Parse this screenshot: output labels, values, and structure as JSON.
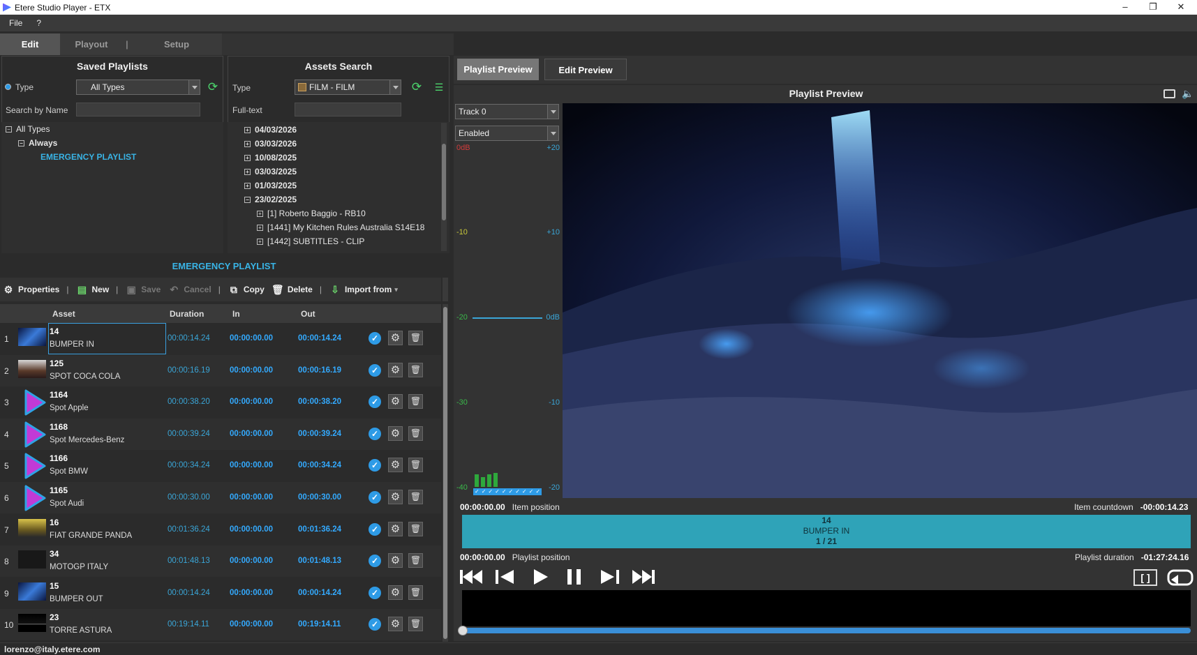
{
  "window": {
    "title": "Etere Studio Player - ETX",
    "min": "–",
    "max": "❐",
    "close": "✕"
  },
  "menu": [
    "File",
    "?"
  ],
  "main_tabs": [
    "Edit",
    "Playout",
    "|",
    "Setup"
  ],
  "saved_playlists": {
    "title": "Saved Playlists",
    "type_label": "Type",
    "type_value": "All Types",
    "search_label": "Search by Name",
    "tree": {
      "root": "All Types",
      "group": "Always",
      "item": "EMERGENCY PLAYLIST"
    }
  },
  "assets_search": {
    "title": "Assets Search",
    "type_label": "Type",
    "type_value": "FILM - FILM",
    "fulltext_label": "Full-text",
    "dates": [
      "04/03/2026",
      "03/03/2026",
      "10/08/2025",
      "03/03/2025",
      "01/03/2025",
      "23/02/2025"
    ],
    "children": [
      "[1]  Roberto Baggio - RB10",
      "[1441]  My Kitchen Rules Australia S14E18",
      "[1442]  SUBTITLES - CLIP"
    ]
  },
  "playlist": {
    "title": "EMERGENCY PLAYLIST",
    "toolbar": {
      "properties": "Properties",
      "new": "New",
      "save": "Save",
      "cancel": "Cancel",
      "copy": "Copy",
      "delete": "Delete",
      "import": "Import from"
    },
    "columns": {
      "asset": "Asset",
      "duration": "Duration",
      "in": "In",
      "out": "Out"
    },
    "rows": [
      {
        "n": "1",
        "id": "14",
        "name": "BUMPER IN",
        "dur": "00:00:14.24",
        "in": "00:00:00.00",
        "out": "00:00:14.24",
        "thumb": "space"
      },
      {
        "n": "2",
        "id": "125",
        "name": "SPOT COCA COLA",
        "dur": "00:00:16.19",
        "in": "00:00:00.00",
        "out": "00:00:16.19",
        "thumb": "people"
      },
      {
        "n": "3",
        "id": "1164",
        "name": "Spot Apple",
        "dur": "00:00:38.20",
        "in": "00:00:00.00",
        "out": "00:00:38.20",
        "thumb": "play"
      },
      {
        "n": "4",
        "id": "1168",
        "name": "Spot Mercedes-Benz",
        "dur": "00:00:39.24",
        "in": "00:00:00.00",
        "out": "00:00:39.24",
        "thumb": "play"
      },
      {
        "n": "5",
        "id": "1166",
        "name": "Spot BMW",
        "dur": "00:00:34.24",
        "in": "00:00:00.00",
        "out": "00:00:34.24",
        "thumb": "play"
      },
      {
        "n": "6",
        "id": "1165",
        "name": "Spot Audi",
        "dur": "00:00:30.00",
        "in": "00:00:00.00",
        "out": "00:00:30.00",
        "thumb": "play"
      },
      {
        "n": "7",
        "id": "16",
        "name": "FIAT GRANDE PANDA",
        "dur": "00:01:36.24",
        "in": "00:00:00.00",
        "out": "00:01:36.24",
        "thumb": "car"
      },
      {
        "n": "8",
        "id": "34",
        "name": "MOTOGP ITALY",
        "dur": "00:01:48.13",
        "in": "00:00:00.00",
        "out": "00:01:48.13",
        "thumb": "dark"
      },
      {
        "n": "9",
        "id": "15",
        "name": "BUMPER OUT",
        "dur": "00:00:14.24",
        "in": "00:00:00.00",
        "out": "00:00:14.24",
        "thumb": "space"
      },
      {
        "n": "10",
        "id": "23",
        "name": "TORRE ASTURA",
        "dur": "00:19:14.11",
        "in": "00:00:00.00",
        "out": "00:19:14.11",
        "thumb": "night"
      }
    ]
  },
  "status": {
    "user": "lorenzo@italy.etere.com"
  },
  "preview": {
    "tab_playlist": "Playlist Preview",
    "tab_edit": "Edit Preview",
    "title": "Playlist Preview",
    "track": "Track 0",
    "enabled": "Enabled",
    "vu_left": [
      "0dB",
      "-10",
      "-20",
      "-30",
      "-40"
    ],
    "vu_right": [
      "+20",
      "+10",
      "0dB",
      "-10",
      "-20"
    ],
    "item_time": "00:00:00.00",
    "item_label": "Item position",
    "countdown_label": "Item countdown",
    "countdown_value": "-00:00:14.23",
    "bar_id": "14",
    "bar_name": "BUMPER IN",
    "bar_count": "1 / 21",
    "pl_time": "00:00:00.00",
    "pl_label": "Playlist position",
    "pl_duration_label": "Playlist duration",
    "pl_duration_value": "-01:27:24.16",
    "mark_icon": "[ ]"
  },
  "colors": {
    "accent": "#39b4e6",
    "time_blue": "#33aaff",
    "bar": "#2fa3b8"
  }
}
